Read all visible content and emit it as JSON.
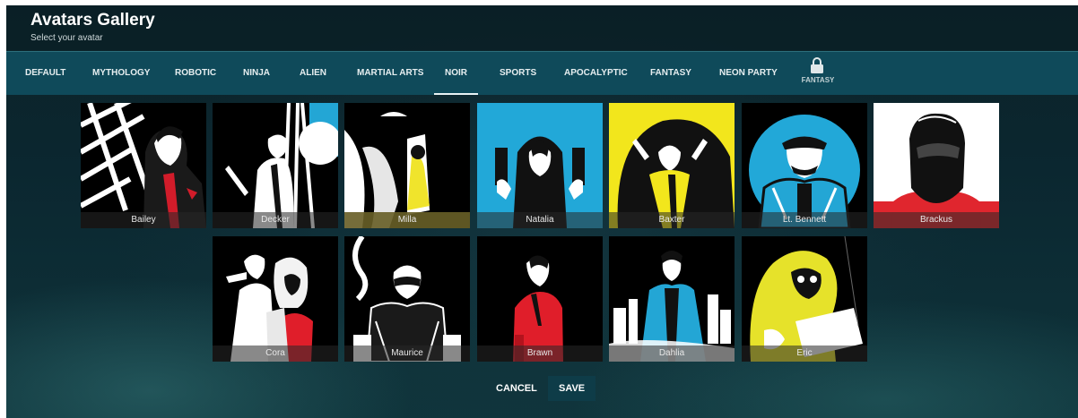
{
  "header": {
    "title": "Avatars Gallery",
    "subtitle": "Select your avatar"
  },
  "tabs": [
    {
      "label": "DEFAULT"
    },
    {
      "label": "MYTHOLOGY"
    },
    {
      "label": "ROBOTIC"
    },
    {
      "label": "NINJA"
    },
    {
      "label": "ALIEN"
    },
    {
      "label": "MARTIAL ARTS"
    },
    {
      "label": "NOIR",
      "active": true
    },
    {
      "label": "SPORTS"
    },
    {
      "label": "APOCALYPTIC"
    },
    {
      "label": "FANTASY"
    },
    {
      "label": "NEON PARTY"
    }
  ],
  "locked_tab": {
    "label": "FANTASY",
    "icon": "lock-icon"
  },
  "avatars": [
    {
      "name": "Bailey"
    },
    {
      "name": "Decker"
    },
    {
      "name": "Milla"
    },
    {
      "name": "Natalia",
      "selected": true
    },
    {
      "name": "Baxter"
    },
    {
      "name": "Lt. Bennett"
    },
    {
      "name": "Brackus"
    },
    {
      "name": "Cora"
    },
    {
      "name": "Maurice"
    },
    {
      "name": "Brawn"
    },
    {
      "name": "Dahlia"
    },
    {
      "name": "Eric"
    }
  ],
  "actions": {
    "cancel": "CANCEL",
    "save": "SAVE"
  },
  "colors": {
    "tabbar": "#0f4a5a",
    "accent_cyan": "#22a8d8",
    "accent_yellow": "#f2e61c",
    "accent_red": "#e01e2a"
  }
}
